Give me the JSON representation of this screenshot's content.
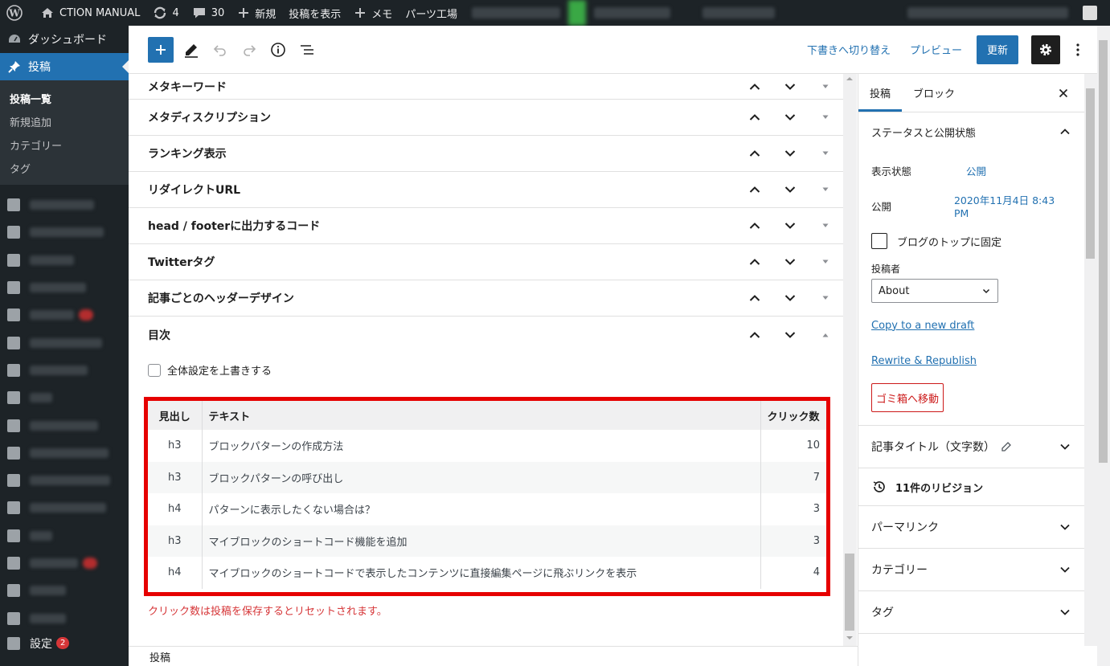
{
  "admin_bar": {
    "site_name": "CTION MANUAL",
    "updates_count": "4",
    "comments_count": "30",
    "new_label": "新規",
    "view_post": "投稿を表示",
    "memo": "メモ",
    "parts": "パーツ工場"
  },
  "sidebar": {
    "dashboard": "ダッシュボード",
    "posts": "投稿",
    "submenu": [
      "投稿一覧",
      "新規追加",
      "カテゴリー",
      "タグ"
    ],
    "settings": "設定",
    "settings_badge": "2"
  },
  "toolbar": {
    "switch_draft": "下書きへ切り替え",
    "preview": "プレビュー",
    "update": "更新"
  },
  "metaboxes": [
    {
      "title": "メタキーワード"
    },
    {
      "title": "メタディスクリプション"
    },
    {
      "title": "ランキング表示"
    },
    {
      "title": "リダイレクトURL"
    },
    {
      "title": "head / footerに出力するコード"
    },
    {
      "title": "Twitterタグ"
    },
    {
      "title": "記事ごとのヘッダーデザイン"
    },
    {
      "title": "目次"
    }
  ],
  "toc": {
    "override_label": "全体設定を上書きする",
    "headers": {
      "heading": "見出し",
      "text": "テキスト",
      "clicks": "クリック数"
    },
    "rows": [
      {
        "level": "h3",
        "text": "ブロックパターンの作成方法",
        "clicks": "10"
      },
      {
        "level": "h3",
        "text": "ブロックパターンの呼び出し",
        "clicks": "7"
      },
      {
        "level": "h4",
        "text": "パターンに表示したくない場合は？",
        "clicks": "3"
      },
      {
        "level": "h3",
        "text": "マイブロックのショートコード機能を追加",
        "clicks": "3"
      },
      {
        "level": "h4",
        "text": "マイブロックのショートコードで表示したコンテンツに直接編集ページに飛ぶリンクを表示",
        "clicks": "4"
      }
    ],
    "note": "クリック数は投稿を保存するとリセットされます。"
  },
  "footer": {
    "breadcrumb": "投稿"
  },
  "settings": {
    "tab_post": "投稿",
    "tab_block": "ブロック",
    "status_title": "ステータスと公開状態",
    "visibility_label": "表示状態",
    "visibility_value": "公開",
    "publish_label": "公開",
    "publish_value": "2020年11月4日 8:43 PM",
    "sticky_label": "ブログのトップに固定",
    "author_label": "投稿者",
    "author_value": "About",
    "copy_link": "Copy to a new draft",
    "rewrite_link": "Rewrite & Republish",
    "trash": "ゴミ箱へ移動",
    "title_count": "記事タイトル（文字数）",
    "revisions": "11件のリビジョン",
    "permalink": "パーマリンク",
    "category": "カテゴリー",
    "tag": "タグ"
  },
  "colors": {
    "accent": "#2271b1",
    "admin_bg": "#1d2327",
    "highlight": "#e60000"
  }
}
